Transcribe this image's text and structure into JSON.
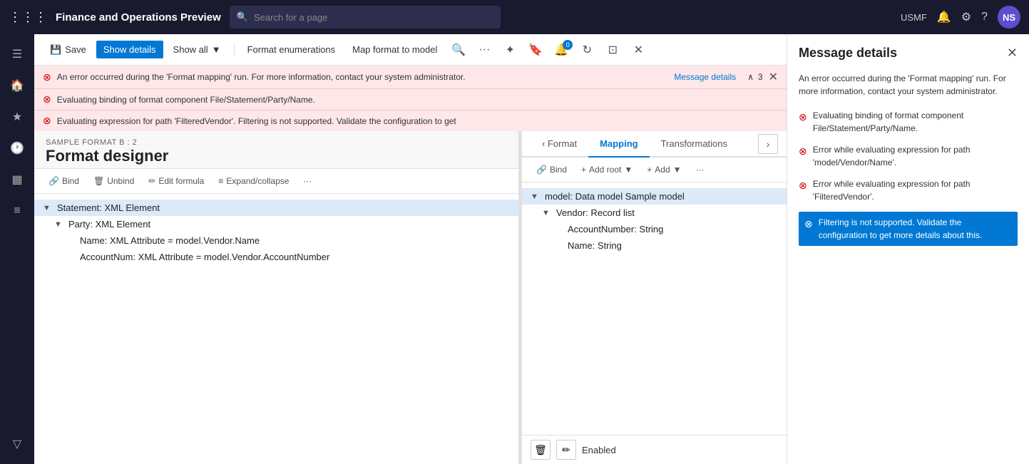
{
  "topnav": {
    "app_title": "Finance and Operations Preview",
    "search_placeholder": "Search for a page",
    "environment": "USMF",
    "user_initials": "NS"
  },
  "toolbar": {
    "save_label": "Save",
    "show_details_label": "Show details",
    "show_all_label": "Show all",
    "format_enumerations_label": "Format enumerations",
    "map_format_label": "Map format to model"
  },
  "errors": {
    "banner1": {
      "text": "An error occurred during the 'Format mapping' run. For more information, contact your system administrator.",
      "link": "Message details",
      "count": "3"
    },
    "banner2": {
      "text": "Evaluating binding of format component File/Statement/Party/Name."
    },
    "banner3": {
      "text": "Evaluating expression for path",
      "detail": "Evaluating expression for path 'FilteredVendor'. Filtering is not supported. Validate the configuration to get"
    }
  },
  "designer": {
    "subtitle": "SAMPLE FORMAT B : 2",
    "title": "Format designer"
  },
  "format_toolbar": {
    "bind": "Bind",
    "unbind": "Unbind",
    "edit_formula": "Edit formula",
    "expand_collapse": "Expand/collapse"
  },
  "format_tree": [
    {
      "label": "Statement: XML Element",
      "indent": 0,
      "toggle": "▼",
      "selected": true
    },
    {
      "label": "Party: XML Element",
      "indent": 1,
      "toggle": "▼",
      "selected": false
    },
    {
      "label": "Name: XML Attribute = model.Vendor.Name",
      "indent": 2,
      "toggle": "",
      "selected": false
    },
    {
      "label": "AccountNum: XML Attribute = model.Vendor.AccountNumber",
      "indent": 2,
      "toggle": "",
      "selected": false
    }
  ],
  "tabs": {
    "format": "Format",
    "mapping": "Mapping",
    "transformations": "Transformations"
  },
  "mapping_toolbar": {
    "bind": "Bind",
    "add_root": "Add root",
    "add": "Add"
  },
  "mapping_tree": [
    {
      "label": "model: Data model Sample model",
      "indent": 0,
      "toggle": "▼",
      "selected": true
    },
    {
      "label": "Vendor: Record list",
      "indent": 1,
      "toggle": "▼",
      "selected": false
    },
    {
      "label": "AccountNumber: String",
      "indent": 2,
      "toggle": "",
      "selected": false
    },
    {
      "label": "Name: String",
      "indent": 2,
      "toggle": "",
      "selected": false
    }
  ],
  "bottom_bar": {
    "status": "Enabled"
  },
  "message_details": {
    "title": "Message details",
    "description": "An error occurred during the 'Format mapping' run. For more information, contact your system administrator.",
    "items": [
      {
        "text": "Evaluating binding of format component File/Statement/Party/Name.",
        "highlighted": false
      },
      {
        "text": "Error while evaluating expression for path 'model/Vendor/Name'.",
        "highlighted": false
      },
      {
        "text": "Error while evaluating expression for path 'FilteredVendor'.",
        "highlighted": false
      },
      {
        "text": "Filtering is not supported. Validate the configuration to get more details about this.",
        "highlighted": true
      }
    ]
  }
}
